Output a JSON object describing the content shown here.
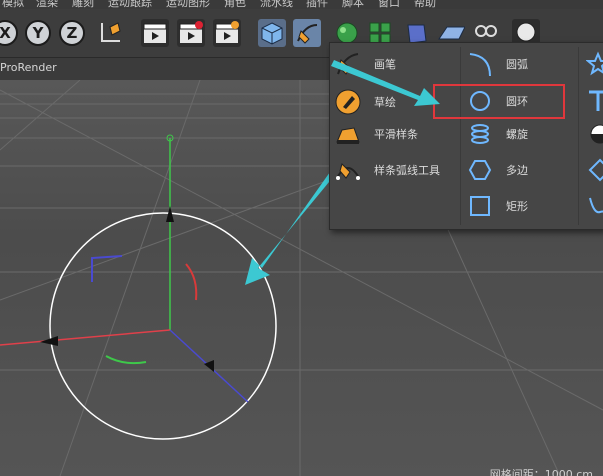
{
  "menubar": {
    "items": [
      "模拟",
      "渲染",
      "雕刻",
      "运动跟踪",
      "运动图形",
      "角色",
      "流水线",
      "插件",
      "脚本",
      "窗口",
      "帮助"
    ]
  },
  "toolbar": {
    "axis_x": "X",
    "axis_y": "Y",
    "axis_z": "Z"
  },
  "viewport": {
    "title": "ProRender",
    "status_text": "网格间距：1000 cm"
  },
  "spline_menu": {
    "col1": [
      {
        "label": "画笔",
        "icon": "pen-icon"
      },
      {
        "label": "草绘",
        "icon": "sketch-icon"
      },
      {
        "label": "平滑样条",
        "icon": "smooth-spline-icon"
      },
      {
        "label": "样条弧线工具",
        "icon": "spline-arc-tool-icon"
      }
    ],
    "col2": [
      {
        "label": "圆弧",
        "icon": "arc-icon"
      },
      {
        "label": "圆环",
        "icon": "circle-icon"
      },
      {
        "label": "螺旋",
        "icon": "helix-icon"
      },
      {
        "label": "多边",
        "icon": "polygon-icon"
      },
      {
        "label": "矩形",
        "icon": "rectangle-icon"
      }
    ],
    "col3_icons": [
      "star-icon",
      "text-icon",
      "cog-wheel-icon",
      "diamond-icon",
      "curve-icon"
    ]
  },
  "colors": {
    "highlight_box": "#e0373c",
    "arrow": "#3cc8d2",
    "icon_accent": "#f0a030",
    "spline_blue": "#6fb8ff"
  }
}
